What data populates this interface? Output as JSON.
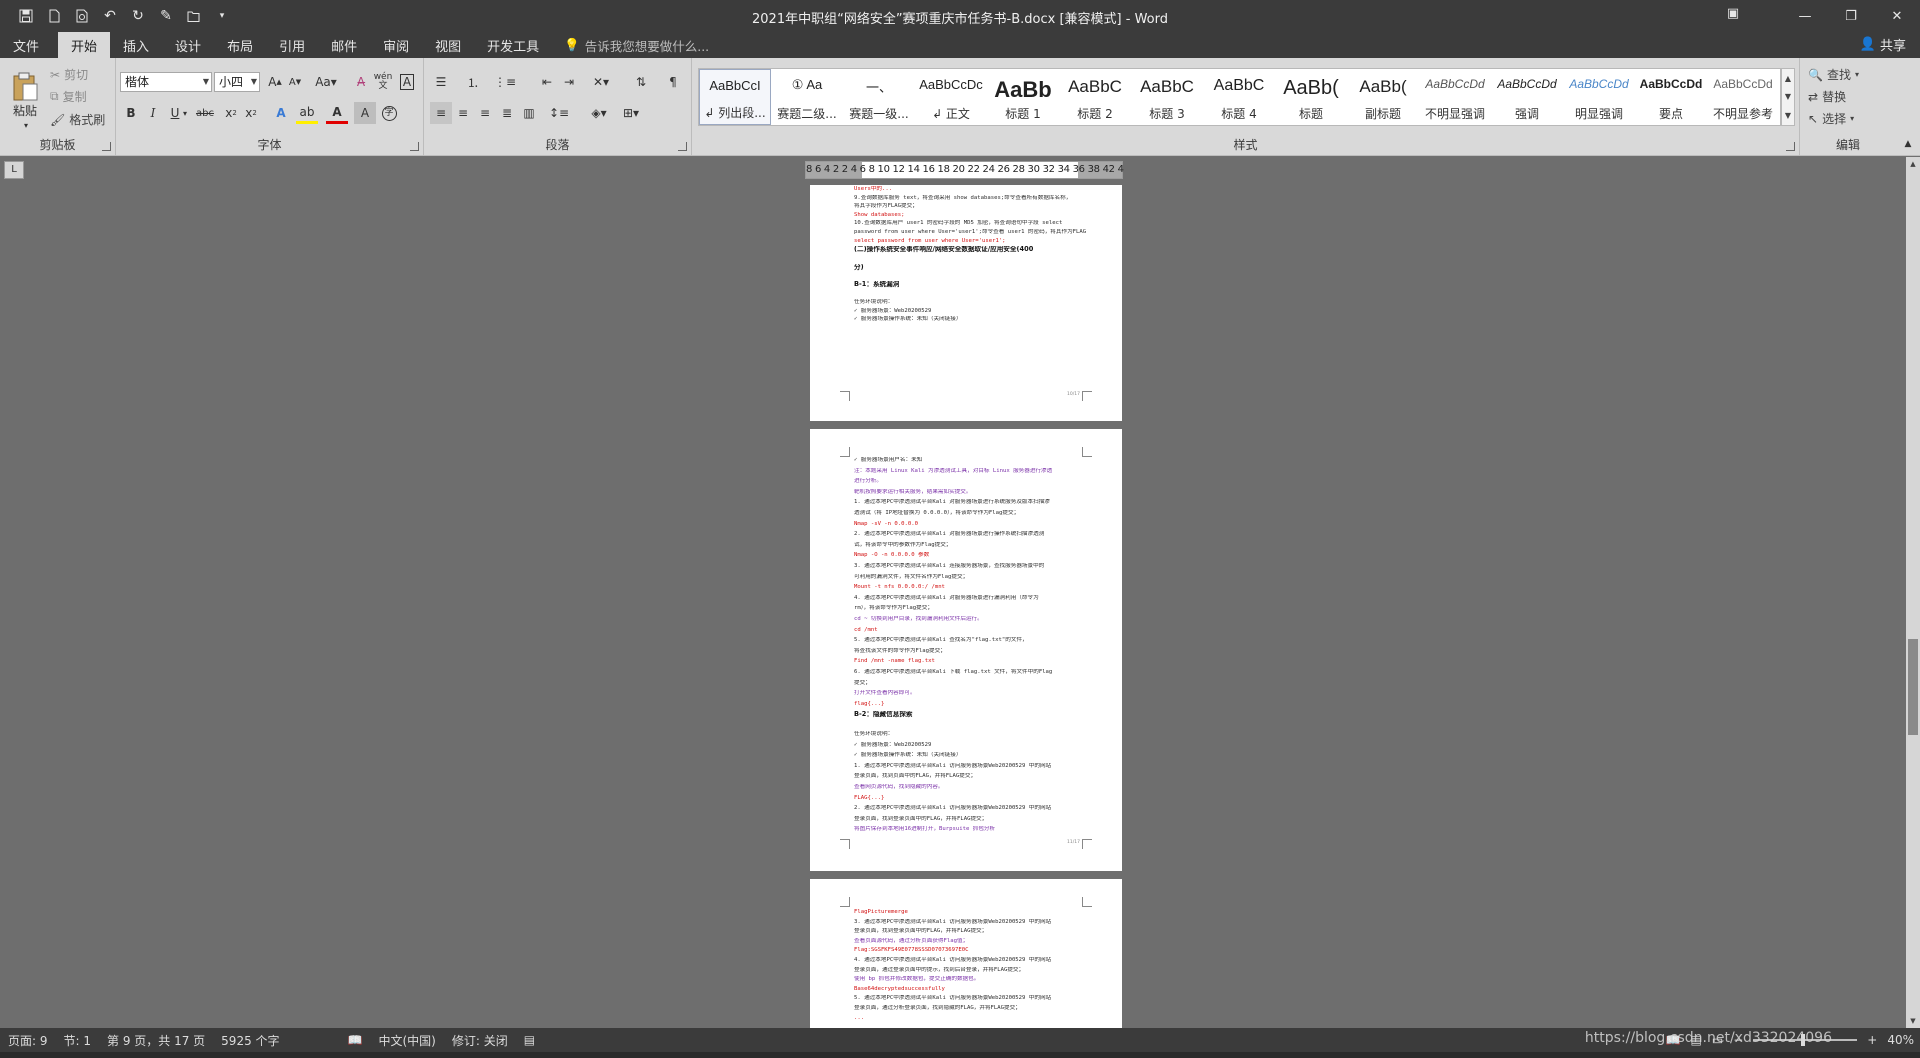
{
  "window": {
    "title": "2021年中职组“网络安全”赛项重庆市任务书-B.docx [兼容模式] - Word",
    "qat_icons": [
      "save-icon",
      "new-doc-icon",
      "print-preview-icon",
      "undo-icon",
      "redo-icon",
      "edit-icon",
      "open-icon",
      "customize-qat-icon"
    ],
    "controls": {
      "minimize": "—",
      "restore": "❐",
      "close": "✕"
    }
  },
  "tabs": [
    "文件",
    "开始",
    "插入",
    "设计",
    "布局",
    "引用",
    "邮件",
    "审阅",
    "视图",
    "开发工具"
  ],
  "active_tab": "开始",
  "tell_me": "告诉我您想要做什么...",
  "share": "共享",
  "clipboard": {
    "paste": "粘贴",
    "cut": "剪切",
    "copy": "复制",
    "format_painter": "格式刷",
    "label": "剪贴板"
  },
  "font": {
    "name": "楷体",
    "size": "小四",
    "label": "字体",
    "wen": "wén"
  },
  "paragraph": {
    "label": "段落"
  },
  "styles": {
    "label": "样式",
    "items": [
      {
        "preview": "AaBbCcI",
        "name": "↲ 列出段..."
      },
      {
        "preview": "① Aa",
        "name": "赛题二级..."
      },
      {
        "preview": "一、",
        "name": "赛题一级..."
      },
      {
        "preview": "AaBbCcDc",
        "name": "↲ 正文"
      },
      {
        "preview": "AaBb",
        "name": "标题 1"
      },
      {
        "preview": "AaBbC",
        "name": "标题 2"
      },
      {
        "preview": "AaBbC",
        "name": "标题 3"
      },
      {
        "preview": "AaBbC",
        "name": "标题 4"
      },
      {
        "preview": "AaBb(",
        "name": "标题"
      },
      {
        "preview": "AaBb(",
        "name": "副标题"
      },
      {
        "preview": "AaBbCcDd",
        "name": "不明显强调"
      },
      {
        "preview": "AaBbCcDd",
        "name": "强调"
      },
      {
        "preview": "AaBbCcDd",
        "name": "明显强调"
      },
      {
        "preview": "AaBbCcDd",
        "name": "要点"
      },
      {
        "preview": "AaBbCcDd",
        "name": "不明显参考"
      }
    ]
  },
  "editing": {
    "find": "查找",
    "replace": "替换",
    "select": "选择",
    "label": "编辑"
  },
  "ruler": {
    "text": "8 6 4 2   2 4 6 8 10 12 14 16 18 20 22 24 26 28 30 32 34 36 38   42 44 46 48",
    "corner": "L"
  },
  "page1": {
    "lines": [
      {
        "t": "Users中的...",
        "c": "red"
      },
      {
        "t": "9.查询数据库服务 text，将查询采用 show databases;命令查看所有数据库名称，",
        "c": "normal"
      },
      {
        "t": "将其字段作为FLAG提交；",
        "c": "normal"
      },
      {
        "t": "Show databases;",
        "c": "red"
      },
      {
        "t": "10.查询数据库用户 user1 的密码字段的 MD5 加密，将查询语句中字段 select",
        "c": "normal"
      },
      {
        "t": "password from user where User='user1';命令查看 user1 的密码，将其作为FLAG提交；",
        "c": "normal"
      },
      {
        "t": "select password from user where User='user1';",
        "c": "red"
      },
      {
        "t": "(二)操作系统安全事件响应/网络安全数据取证/应用安全(400",
        "c": "bold"
      },
      {
        "t": "分)",
        "c": "bold"
      },
      {
        "t": "B-1：系统漏洞",
        "c": "bold"
      },
      {
        "t": "任务环境说明：",
        "c": "normal"
      },
      {
        "t": "✓ 服务器场景：Web20200529",
        "c": "normal"
      },
      {
        "t": "✓ 服务器场景操作系统：未知（关闭链接）",
        "c": "normal"
      }
    ],
    "page_no": "10/17"
  },
  "page2": {
    "lines": [
      {
        "t": "✓ 服务器场景用户名：未知",
        "c": "normal"
      },
      {
        "t": "注：本题采用 Linux Kali 为渗透测试工具，对目标 Linux 服务器进行渗透",
        "c": "purple"
      },
      {
        "t": "进行分析。",
        "c": "purple"
      },
      {
        "t": "靶机按照要求运行相关服务，结果需如实提交。",
        "c": "purple"
      },
      {
        "t": "1. 通过本地PC中渗透测试平台Kali 对服务器场景进行系统服务及版本扫描渗",
        "c": "normal"
      },
      {
        "t": "   透测试（将 IP地址替换为 0.0.0.0），将该命令作为Flag提交；",
        "c": "normal"
      },
      {
        "t": "   Nmap -sV -n 0.0.0.0",
        "c": "red"
      },
      {
        "t": "2. 通过本地PC中渗透测试平台Kali 对服务器场景进行操作系统扫描渗透测",
        "c": "normal"
      },
      {
        "t": "   试，将该命令中的参数作为Flag提交；",
        "c": "normal"
      },
      {
        "t": "   Nmap -O -n 0.0.0.0 参数",
        "c": "red"
      },
      {
        "t": "3. 通过本地PC中渗透测试平台Kali 连接服务器场景，查找服务器场景中的",
        "c": "normal"
      },
      {
        "t": "   可利用的漏洞文件，将文件名作为Flag提交；",
        "c": "normal"
      },
      {
        "t": "   Mount -t nfs 0.0.0.0:/ /mnt",
        "c": "red"
      },
      {
        "t": "4. 通过本地PC中渗透测试平台Kali 对服务器场景进行漏洞利用（命令为",
        "c": "normal"
      },
      {
        "t": "   rm），将该命令作为Flag提交；",
        "c": "normal"
      },
      {
        "t": "   cd ~ 切换到用户目录，找到漏洞利用文件后运行。",
        "c": "purple"
      },
      {
        "t": "   cd /mnt",
        "c": "red"
      },
      {
        "t": "5. 通过本地PC中渗透测试平台Kali 查找名为\"flag.txt\"的文件，",
        "c": "normal"
      },
      {
        "t": "   将查找该文件的命令作为Flag提交；",
        "c": "normal"
      },
      {
        "t": "   Find /mnt -name flag.txt",
        "c": "red"
      },
      {
        "t": "6. 通过本地PC中渗透测试平台Kali 下载 flag.txt 文件，将文件中的Flag",
        "c": "normal"
      },
      {
        "t": "   提交；",
        "c": "normal"
      },
      {
        "t": "   打开文件查看内容即可。",
        "c": "purple"
      },
      {
        "t": "   flag{...}",
        "c": "red"
      },
      {
        "t": "B-2：隐藏信息探索",
        "c": "bold"
      },
      {
        "t": "任务环境说明：",
        "c": "normal"
      },
      {
        "t": "✓ 服务器场景：Web20200529",
        "c": "normal"
      },
      {
        "t": "✓ 服务器场景操作系统：未知（关闭链接）",
        "c": "normal"
      },
      {
        "t": "1. 通过本地PC中渗透测试平台Kali 访问服务器场景Web20200529 中的网站",
        "c": "normal"
      },
      {
        "t": "   登录页面，找到页面中的FLAG，并将FLAG提交；",
        "c": "normal"
      },
      {
        "t": "   查看网页源代码，找到隐藏的内容。",
        "c": "purple"
      },
      {
        "t": "   FLAG{...}",
        "c": "red"
      },
      {
        "t": "2. 通过本地PC中渗透测试平台Kali 访问服务器场景Web20200529 中的网站",
        "c": "normal"
      },
      {
        "t": "   登录页面，找到登录页面中的FLAG，并将FLAG提交；",
        "c": "normal"
      },
      {
        "t": "   将图片保存到本地用16进制打开，Burpsuite 抓包分析",
        "c": "purple"
      }
    ],
    "page_no": "11/17"
  },
  "page3": {
    "lines": [
      {
        "t": "FlagPicturemerge",
        "c": "red"
      },
      {
        "t": "3. 通过本地PC中渗透测试平台Kali 访问服务器场景Web20200529 中的网站",
        "c": "normal"
      },
      {
        "t": "   登录页面，找到登录页面中的FLAG，并将FLAG提交；",
        "c": "normal"
      },
      {
        "t": "   查看页面源代码，通过分析页面获得Flag值；",
        "c": "purple"
      },
      {
        "t": "   Flag:SGSFKFS49E0778SSSD07073697E0C",
        "c": "red"
      },
      {
        "t": "4. 通过本地PC中渗透测试平台Kali 访问服务器场景Web20200529 中的网站",
        "c": "normal"
      },
      {
        "t": "   登录页面，通过登录页面中的提示，找到后台登录，并将FLAG提交；",
        "c": "normal"
      },
      {
        "t": "   使用 bp 抓包并修改数据包，提交正确的数据包。",
        "c": "purple"
      },
      {
        "t": "   Base64decryptedsuccessfully",
        "c": "red"
      },
      {
        "t": "5. 通过本地PC中渗透测试平台Kali 访问服务器场景Web20200529 中的网站",
        "c": "normal"
      },
      {
        "t": "   登录页面，通过分析登录页面，找到隐藏的FLAG，并将FLAG提交；",
        "c": "normal"
      },
      {
        "t": "   ...",
        "c": "red"
      }
    ]
  },
  "status": {
    "page": "页面: 9",
    "section": "节: 1",
    "page_of": "第 9 页，共 17 页",
    "words": "5925 个字",
    "lang": "中文(中国)",
    "track": "修订: 关闭",
    "zoom": "40%",
    "watermark": "https://blog.csdn.net/xd332024096"
  }
}
